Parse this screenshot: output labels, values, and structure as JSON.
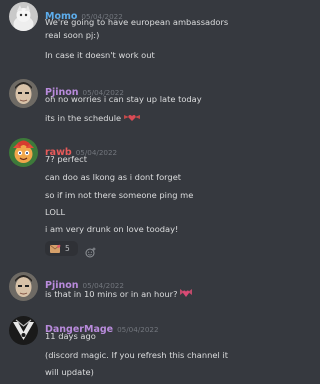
{
  "colors": {
    "background": "#36393f",
    "text": "#dcddde",
    "timestamp": "#72767d",
    "momo": "#5dadec",
    "pjinon": "#b98bdc",
    "rawb": "#e85a5a",
    "dangermage": "#b98bdc"
  },
  "messages": [
    {
      "author": "Momo",
      "timestamp": "05/04/2022",
      "lines": [
        "We're going to have european ambassadors",
        "real soon pj:)",
        "In case it doesn't work out"
      ]
    },
    {
      "author": "Pjinon",
      "timestamp": "05/04/2022",
      "lines": [
        "oh no worries i can stay up late today",
        "its in the schedule"
      ],
      "inline_emoji": "heart-wings-emoji"
    },
    {
      "author": "rawb",
      "timestamp": "05/04/2022",
      "lines": [
        "7? perfect",
        "can doo as lkong as i dont forget",
        "so if im not there someone ping me",
        "LOLL",
        "i am very drunk on love tooday!"
      ],
      "reaction": {
        "icon": "love-letter-emoji",
        "count": "5"
      }
    },
    {
      "author": "Pjinon",
      "timestamp": "05/04/2022",
      "lines": [
        "is that in 10 mins or in an hour?"
      ],
      "inline_emoji": "heart-wings-emoji"
    },
    {
      "author": "DangerMage",
      "timestamp": "05/04/2022",
      "lines": [
        "11 days ago",
        "(discord magic. If you refresh this channel it",
        "will update)"
      ]
    }
  ]
}
